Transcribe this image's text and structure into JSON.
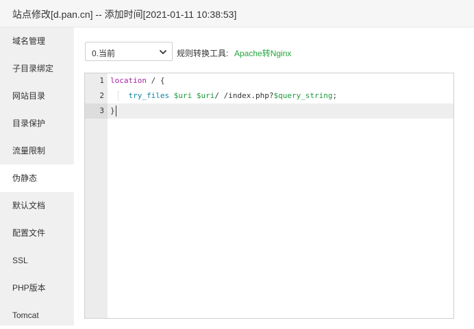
{
  "window": {
    "title": "站点修改[d.pan.cn] -- 添加时间[2021-01-11 10:38:53]"
  },
  "sidebar": {
    "items": [
      {
        "label": "域名管理",
        "active": false
      },
      {
        "label": "子目录绑定",
        "active": false
      },
      {
        "label": "网站目录",
        "active": false
      },
      {
        "label": "目录保护",
        "active": false
      },
      {
        "label": "流量限制",
        "active": false
      },
      {
        "label": "伪静态",
        "active": true
      },
      {
        "label": "默认文档",
        "active": false
      },
      {
        "label": "配置文件",
        "active": false
      },
      {
        "label": "SSL",
        "active": false
      },
      {
        "label": "PHP版本",
        "active": false
      },
      {
        "label": "Tomcat",
        "active": false
      }
    ]
  },
  "toolbar": {
    "select_value": "0.当前",
    "tool_label": "规则转换工具:",
    "tool_link": "Apache转Nginx"
  },
  "editor": {
    "line_numbers": [
      "1",
      "2",
      "3"
    ],
    "lines": [
      {
        "text": "location / {"
      },
      {
        "text": "try_files $uri $uri/ /index.php?$query_string;"
      },
      {
        "text": "}"
      }
    ],
    "active_line": 3
  },
  "colors": {
    "accent_green": "#20a53a",
    "sidebar_bg": "#f0f0f0",
    "keyword": "#a626a4",
    "function": "#0b82a4",
    "variable": "#1a9a3a"
  }
}
